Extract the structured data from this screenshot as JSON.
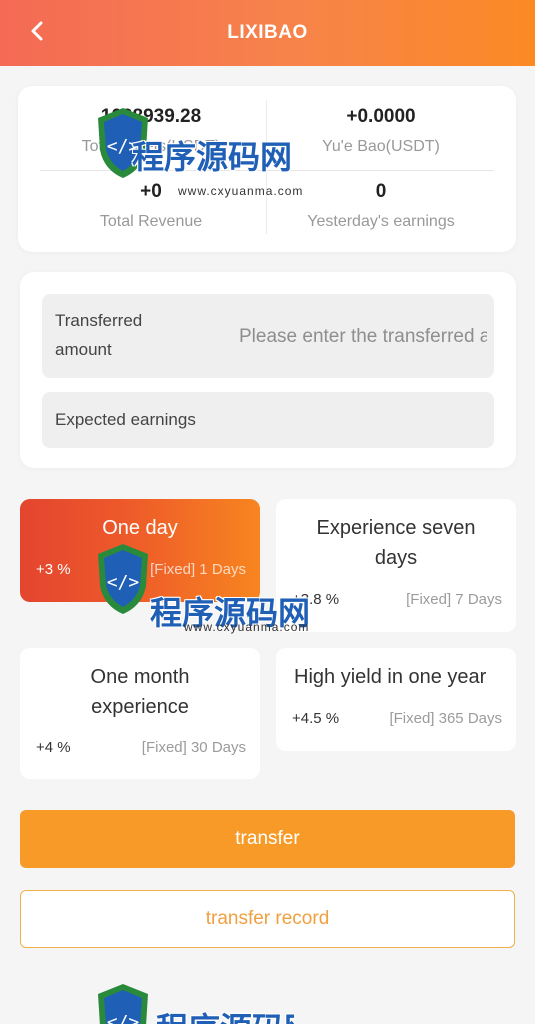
{
  "header": {
    "title": "LIXIBAO",
    "back_icon": "chevron-left-icon"
  },
  "stats": {
    "total": {
      "value": "1028939.28",
      "label": "Total assets(USDT)"
    },
    "yuebao": {
      "value": "+0.0000",
      "label": "Yu'e Bao(USDT)"
    },
    "revenue": {
      "value": "+0",
      "label": "Total Revenue"
    },
    "yesterday": {
      "value": "0",
      "label": "Yesterday's earnings"
    }
  },
  "form": {
    "transfer_label": "Transferred amount",
    "transfer_placeholder": "Please enter the transferred amount",
    "expected_label": "Expected earnings"
  },
  "plans": [
    {
      "name": "One day",
      "rate": "+3 %",
      "term": "[Fixed] 1 Days",
      "active": true
    },
    {
      "name": "Experience seven days",
      "rate": "+3.8 %",
      "term": "[Fixed] 7 Days",
      "active": false
    },
    {
      "name": "One month experience",
      "rate": "+4 %",
      "term": "[Fixed] 30 Days",
      "active": false
    },
    {
      "name": "High yield in one year",
      "rate": "+4.5 %",
      "term": "[Fixed] 365 Days",
      "active": false
    }
  ],
  "buttons": {
    "transfer": "transfer",
    "record": "transfer record"
  },
  "watermark": {
    "text_cn": "程序源码网",
    "text_en": "www.cxyuanma.com"
  },
  "colors": {
    "accent": "#f79a28",
    "header_start": "#f46a55",
    "header_end": "#fb8a24",
    "active_plan": "#e3452f"
  }
}
